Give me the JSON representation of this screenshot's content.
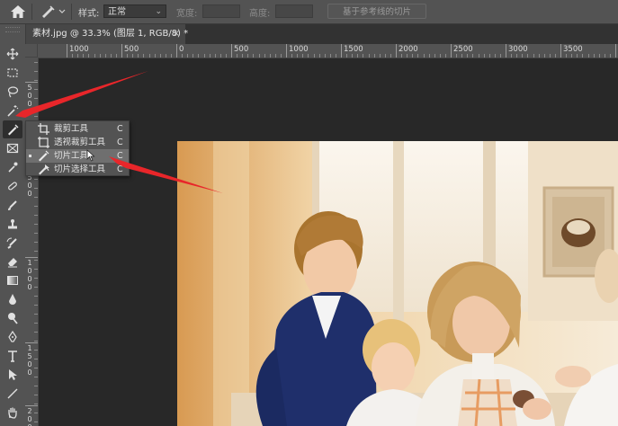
{
  "options_bar": {
    "style_label": "样式:",
    "style_value": "正常",
    "width_label": "宽度:",
    "height_label": "高度:",
    "slices_from_guides_label": "基于参考线的切片"
  },
  "document_tab": {
    "title": "素材.jpg @ 33.3% (图层 1, RGB/8) *",
    "close": "×"
  },
  "ruler": {
    "horizontal_labels": [
      "1000",
      "500",
      "0",
      "500",
      "1000",
      "1500",
      "2000",
      "2500",
      "3000",
      "3500",
      "4000"
    ],
    "vertical_labels": [
      "5",
      "0",
      "0",
      "5",
      "0",
      "0",
      "1",
      "0",
      "0",
      "0",
      "1",
      "5",
      "0",
      "0",
      "2",
      "0",
      "0",
      "0"
    ]
  },
  "toolbar": {
    "tools": [
      "move-icon",
      "marquee-icon",
      "lasso-icon",
      "magic-wand-icon",
      "slice-tool-icon",
      "frame-icon",
      "eyedropper-icon",
      "healing-brush-icon",
      "brush-icon",
      "clone-stamp-icon",
      "history-brush-icon",
      "eraser-icon",
      "gradient-icon",
      "blur-icon",
      "dodge-icon",
      "pen-icon",
      "type-icon",
      "path-selection-icon",
      "line-icon",
      "hand-icon"
    ],
    "active_tool": "slice-tool-icon"
  },
  "flyout": {
    "items": [
      {
        "label": "裁剪工具",
        "shortcut": "C",
        "icon": "crop-icon"
      },
      {
        "label": "透视裁剪工具",
        "shortcut": "C",
        "icon": "perspective-crop-icon"
      },
      {
        "label": "切片工具",
        "shortcut": "C",
        "icon": "slice-icon",
        "selected": true
      },
      {
        "label": "切片选择工具",
        "shortcut": "C",
        "icon": "slice-select-icon"
      }
    ]
  },
  "colors": {
    "panel": "#535353",
    "canvas": "#282828",
    "annotation_arrow": "#e8262a"
  }
}
